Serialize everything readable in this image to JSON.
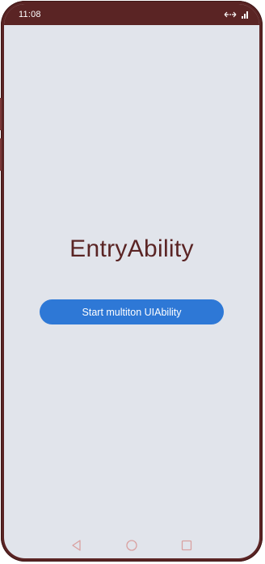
{
  "status_bar": {
    "time": "11:08",
    "icons": [
      "link-arrows-icon",
      "signal-icon"
    ]
  },
  "main": {
    "title": "EntryAbility",
    "button_label": "Start multiton UIAbility"
  },
  "nav_bar": {
    "items": [
      "back-triangle-icon",
      "home-circle-icon",
      "recents-square-icon"
    ]
  },
  "colors": {
    "frame": "#5a2424",
    "screen_background": "#e1e4eb",
    "title_text": "#5a2424",
    "button_background": "#2e78d6",
    "button_text": "#ffffff",
    "nav_icons": "#d9a0a0"
  }
}
